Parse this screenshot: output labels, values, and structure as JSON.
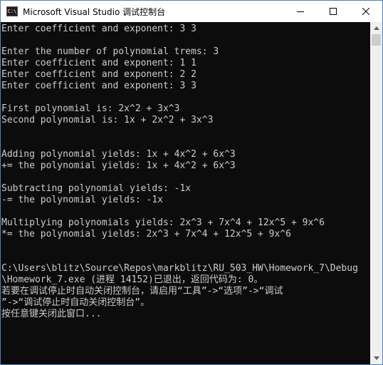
{
  "window": {
    "title": "Microsoft Visual Studio 调试控制台",
    "icon_text": "C:\\",
    "icons": {
      "app": "console-app-icon",
      "minimize": "minimize-icon",
      "maximize": "maximize-icon",
      "close": "close-icon"
    }
  },
  "console": {
    "lines": [
      "Enter coefficient and exponent: 3 3",
      "",
      "Enter the number of polynomial trems: 3",
      "Enter coefficient and exponent: 1 1",
      "Enter coefficient and exponent: 2 2",
      "Enter coefficient and exponent: 3 3",
      "",
      "First polynomial is: 2x^2 + 3x^3",
      "Second polynomial is: 1x + 2x^2 + 3x^3",
      "",
      "",
      "Adding polynomial yields: 1x + 4x^2 + 6x^3",
      "+= the polynomial yields: 1x + 4x^2 + 6x^3",
      "",
      "Subtracting polynomial yields: -1x",
      "-= the polynomial yields: -1x",
      "",
      "Multiplying polynomials yields: 2x^3 + 7x^4 + 12x^5 + 9x^6",
      "*= the polynomial yields: 2x^3 + 7x^4 + 12x^5 + 9x^6",
      "",
      "",
      "C:\\Users\\blitz\\Source\\Repos\\markblitz\\RU_503_HW\\Homework_7\\Debug",
      "\\Homework_7.exe (进程 14152)已退出，返回代码为: 0。",
      "若要在调试停止时自动关闭控制台，请启用“工具”->“选项”->“调试",
      "”->“调试停止时自动关闭控制台”。",
      "按任意键关闭此窗口..."
    ]
  },
  "scrollbar": {
    "up_icon": "scroll-up-arrow-icon",
    "down_icon": "scroll-down-arrow-icon"
  }
}
